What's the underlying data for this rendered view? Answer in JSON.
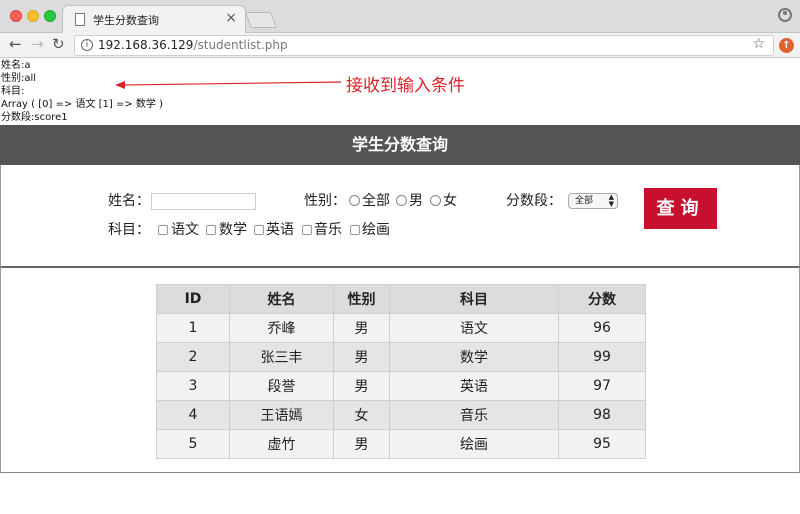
{
  "browser": {
    "tab_title": "学生分数查询",
    "tab_close": "×",
    "url_host": "192.168.36.129",
    "url_path": "/studentlist.php"
  },
  "debug": {
    "lines": [
      "姓名:a",
      "性别:all",
      "科目:",
      "Array ( [0] => 语文 [1] => 数学 )",
      "分数段:score1"
    ]
  },
  "annotation": "接收到输入条件",
  "header": {
    "title": "学生分数查询"
  },
  "form": {
    "name_label": "姓名：",
    "name_value": "",
    "gender_label": "性别：",
    "gender_options": [
      "全部",
      "男",
      "女"
    ],
    "score_label": "分数段：",
    "score_selected": "全部",
    "subject_label": "科目：",
    "subjects": [
      "语文",
      "数学",
      "英语",
      "音乐",
      "绘画"
    ],
    "query_button": "查询"
  },
  "table": {
    "headers": [
      "ID",
      "姓名",
      "性别",
      "科目",
      "分数"
    ],
    "rows": [
      [
        "1",
        "乔峰",
        "男",
        "语文",
        "96"
      ],
      [
        "2",
        "张三丰",
        "男",
        "数学",
        "99"
      ],
      [
        "3",
        "段誉",
        "男",
        "英语",
        "97"
      ],
      [
        "4",
        "王语嫣",
        "女",
        "音乐",
        "98"
      ],
      [
        "5",
        "虚竹",
        "男",
        "绘画",
        "95"
      ]
    ]
  },
  "colors": {
    "header_bg": "#555555",
    "button_bg": "#c8102e",
    "annotation": "#d9252a"
  }
}
